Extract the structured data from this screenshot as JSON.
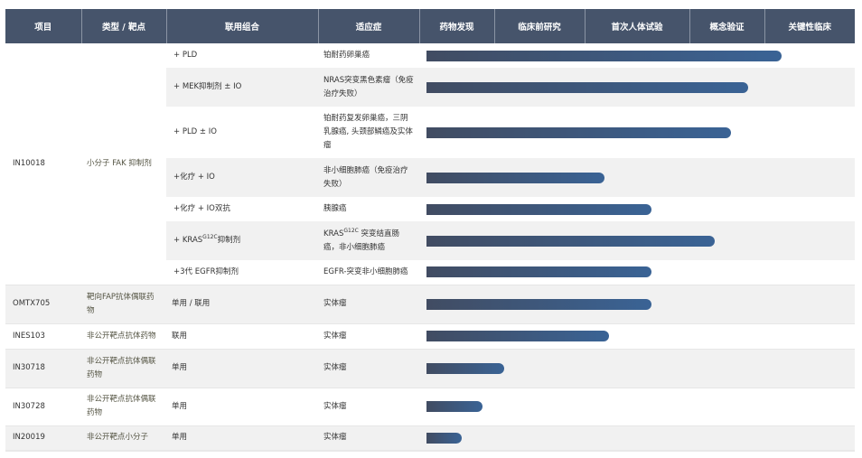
{
  "headers": [
    "项目",
    "类型 / 靶点",
    "联用组合",
    "适应症",
    "药物发现",
    "临床前研究",
    "首次人体试验",
    "概念验证",
    "关键性临床"
  ],
  "in10018": {
    "project": "IN10018",
    "type": "小分子 FAK 抑制剂",
    "rows": [
      {
        "combo": "+ PLD",
        "indication": "铂耐药卵巢癌",
        "progress": 0.846
      },
      {
        "combo": "+ MEK抑制剂 ± IO",
        "indication": "NRAS突变黑色素瘤（免疫治疗失败）",
        "progress": 0.768
      },
      {
        "combo": "+ PLD ± IO",
        "indication": "铂耐药复发卵巢癌，三阴乳腺癌, 头颈部鳞癌及实体瘤",
        "progress": 0.728
      },
      {
        "combo": "+化疗 + IO",
        "indication": "非小细胞肺癌（免疫治疗失败）",
        "progress": 0.432
      },
      {
        "combo": "+化疗 + IO双抗",
        "indication": "胰腺癌",
        "progress": 0.542
      },
      {
        "combo_pre": "+ KRAS",
        "combo_sup": "G12C",
        "combo_post": "抑制剂",
        "ind_pre": "KRAS",
        "ind_sup": "G12C",
        "ind_post": " 突变结直肠癌，非小细胞肺癌",
        "progress": 0.69
      },
      {
        "combo": "+3代 EGFR抑制剂",
        "indication": "EGFR-突变非小细胞肺癌",
        "progress": 0.542
      }
    ]
  },
  "others": [
    {
      "project": "OMTX705",
      "type": "靶向FAP抗体偶联药物",
      "combo": "单用 / 联用",
      "indication": "实体瘤",
      "progress": 0.542
    },
    {
      "project": "INES103",
      "type": "非公开靶点抗体药物",
      "combo": "联用",
      "indication": "实体瘤",
      "progress": 0.443
    },
    {
      "project": "IN30718",
      "type": "非公开靶点抗体偶联药物",
      "combo": "单用",
      "indication": "实体瘤",
      "progress": 0.198
    },
    {
      "project": "IN30728",
      "type": "非公开靶点抗体偶联药物",
      "combo": "单用",
      "indication": "实体瘤",
      "progress": 0.148
    },
    {
      "project": "IN20019",
      "type": "非公开靶点小分子",
      "combo": "单用",
      "indication": "实体瘤",
      "progress": 0.099
    }
  ],
  "colors": {
    "header": "#46546b",
    "bar_start": "#414c62",
    "bar_end": "#3a6395",
    "stripe": "#f1f1f1"
  }
}
